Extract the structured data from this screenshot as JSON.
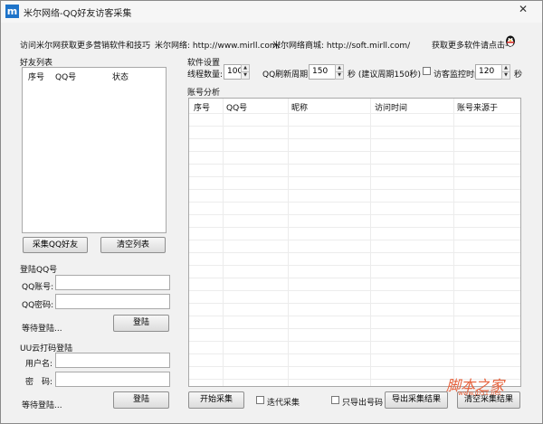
{
  "window": {
    "title": "米尔网络-QQ好友访客采集",
    "app_icon": "m",
    "close": "✕"
  },
  "top_bar": {
    "promo": "访问米尔网获取更多营销软件和技巧",
    "site_label": "米尔网络: http://www.mirll.com/",
    "shop_label": "米尔网络商城: http://soft.mirll.com/",
    "more_software": "获取更多软件请点击→"
  },
  "friend_list": {
    "title": "好友列表",
    "columns": [
      "序号",
      "QQ号",
      "状态"
    ],
    "collect_button": "采集QQ好友",
    "clear_button": "清空列表"
  },
  "qq_login": {
    "title": "登陆QQ号",
    "account_label": "QQ账号:",
    "password_label": "QQ密码:",
    "status": "等待登陆...",
    "login_button": "登陆"
  },
  "uu_login": {
    "title": "UU云打码登陆",
    "user_label": "用户名:",
    "password_label": "密　码:",
    "status": "等待登陆...",
    "login_button": "登陆"
  },
  "settings": {
    "title": "软件设置",
    "threads_label": "线程数量:",
    "threads_value": "100",
    "refresh_label": "QQ刷新周期:",
    "refresh_value": "150",
    "refresh_unit": "秒 (建议周期150秒)",
    "monitor_label": "访客监控时间",
    "monitor_value": "120",
    "monitor_unit": "秒"
  },
  "analysis": {
    "title": "账号分析",
    "columns": [
      "序号",
      "QQ号",
      "昵称",
      "访问时间",
      "账号来源于"
    ]
  },
  "bottom_bar": {
    "start_button": "开始采集",
    "iterate_label": "迭代采集",
    "export_numbers_label": "只导出号码",
    "export_button": "导出采集结果",
    "clear_button": "清空采集结果"
  },
  "watermark": {
    "text": "脚本之家",
    "url": "www.jb51.net"
  }
}
